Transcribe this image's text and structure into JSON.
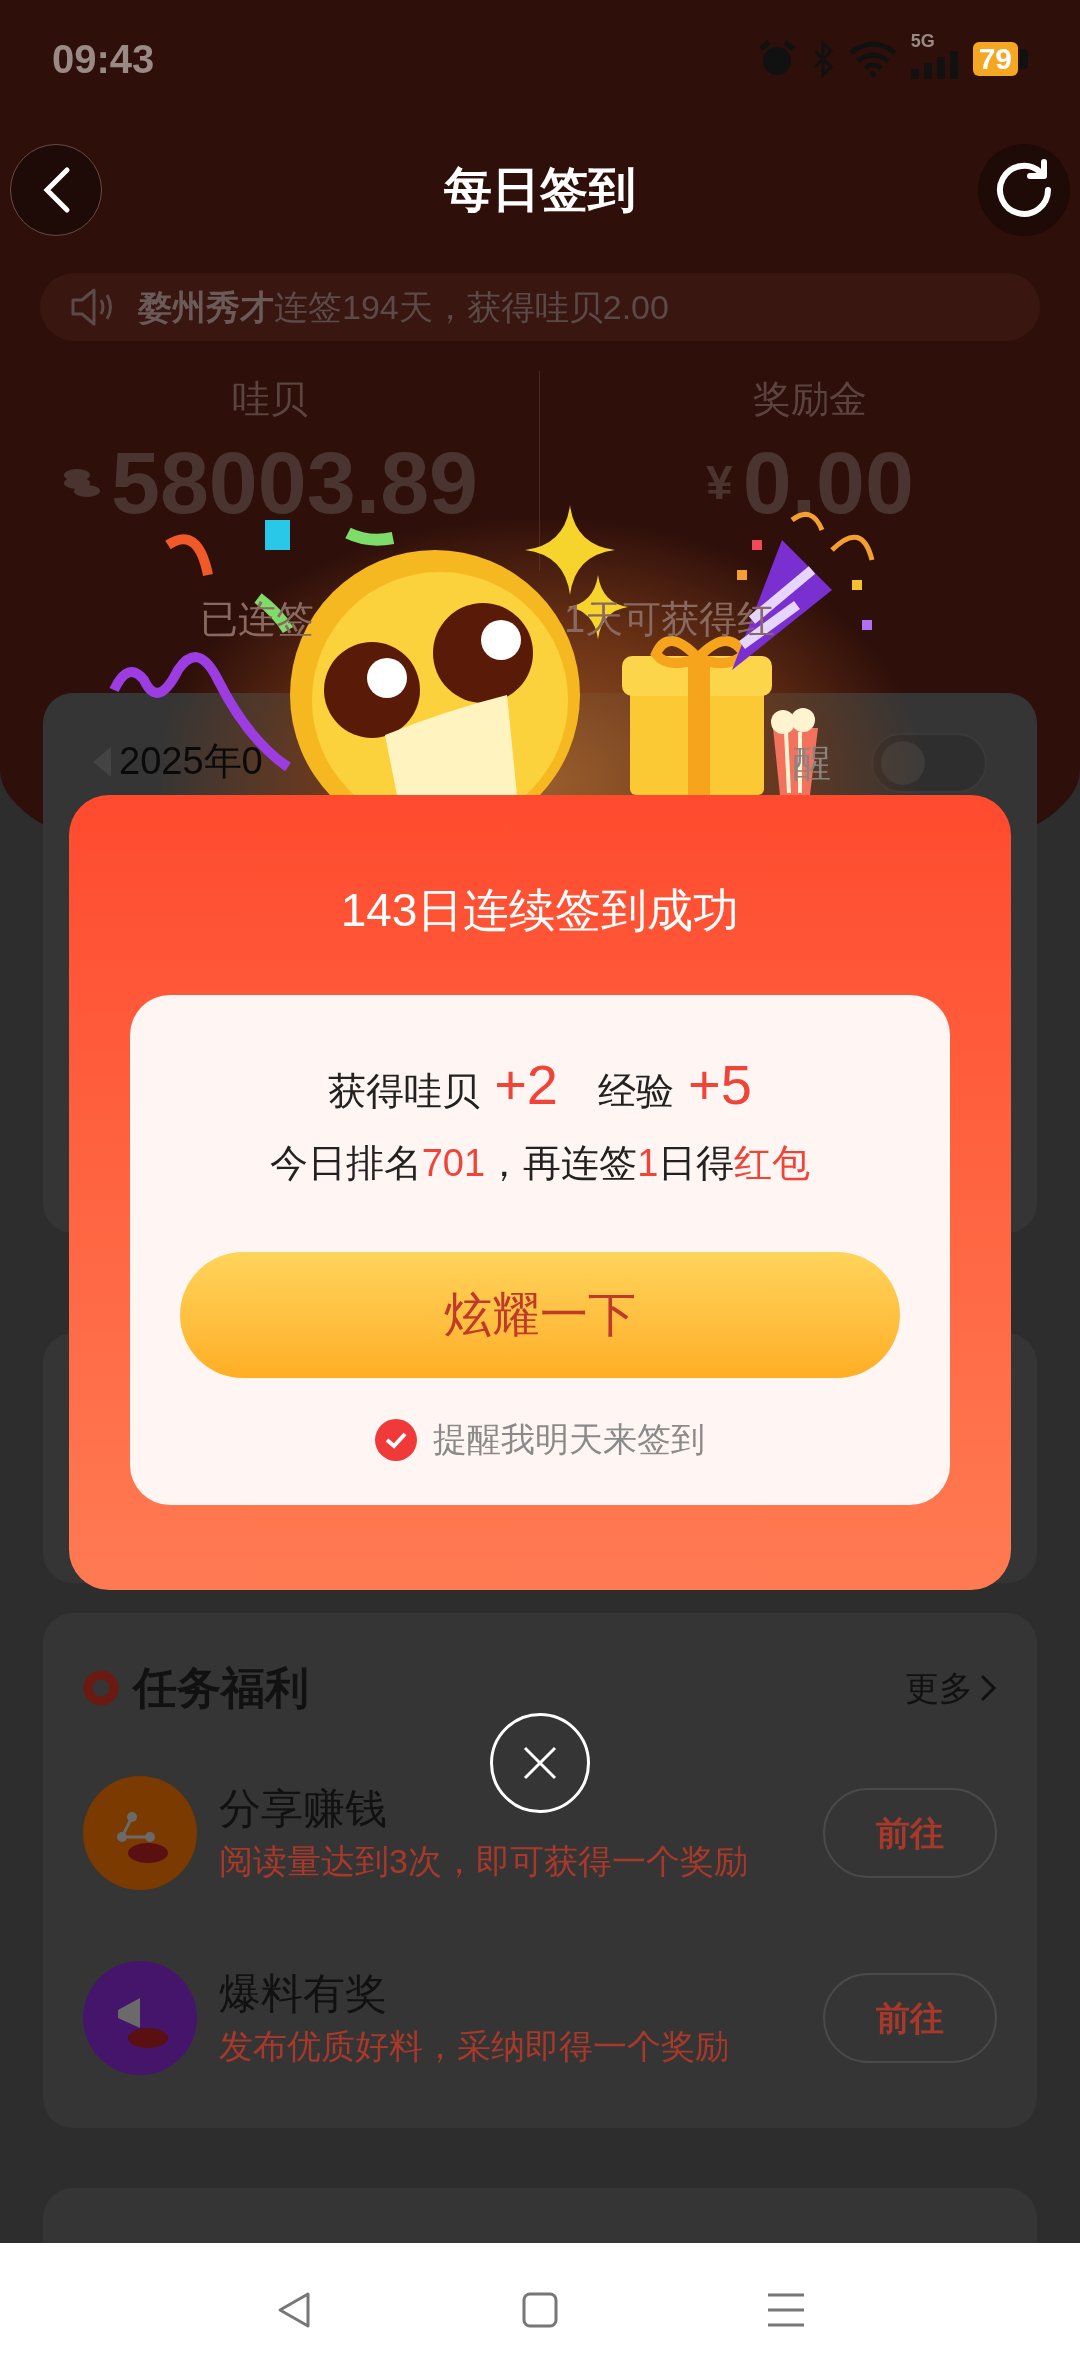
{
  "status_bar": {
    "time": "09:43",
    "network": "5G",
    "battery": "79"
  },
  "header": {
    "title": "每日签到"
  },
  "notice": {
    "text": "**婺州秀才**连签194天，获得哇贝2.00"
  },
  "stats": [
    {
      "kind": "coins",
      "label": "哇贝",
      "value": "58003.89"
    },
    {
      "kind": "cash",
      "label": "奖励金",
      "currency": "¥",
      "value": "0.00"
    }
  ],
  "streak_hint": {
    "parts": [
      "已连签",
      "1天可获得红"
    ]
  },
  "calendar": {
    "month": "2025年0",
    "reminder_label": "醒",
    "reminder_on": false
  },
  "popup": {
    "title": "143日连续签到成功",
    "rewards": [
      {
        "label": "获得哇贝",
        "value": "+2"
      },
      {
        "label": "经验",
        "value": "+5"
      }
    ],
    "rank_line": [
      {
        "text": "今日排名",
        "highlight": false
      },
      {
        "text": "701",
        "highlight": true
      },
      {
        "text": "，再连签",
        "highlight": false
      },
      {
        "text": "1",
        "highlight": true
      },
      {
        "text": "日得",
        "highlight": false
      },
      {
        "text": "红包",
        "highlight": true
      }
    ],
    "button": "炫耀一下",
    "reminder": {
      "label": "提醒我明天来签到",
      "checked": true
    }
  },
  "tasks": {
    "title": "任务福利",
    "more": "更多",
    "items": [
      {
        "kind": "share",
        "title": "分享赚钱",
        "desc": "阅读量达到3次，即可获得一个奖励",
        "button": "前往",
        "color": "#7a3a00"
      },
      {
        "kind": "tip",
        "title": "爆料有奖",
        "desc": "发布优质好料，采纳即得一个奖励",
        "button": "前往",
        "color": "#45146b"
      }
    ]
  }
}
